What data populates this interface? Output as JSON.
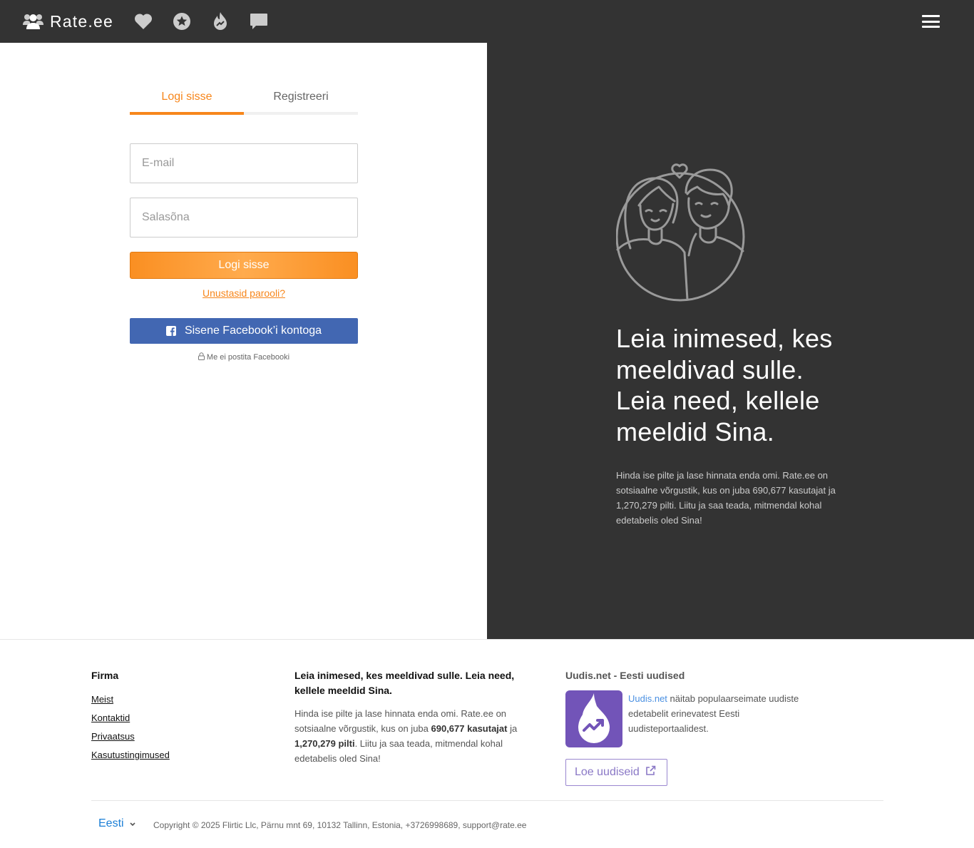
{
  "navbar": {
    "brand": "Rate.ee",
    "icons": [
      "users-icon",
      "heart-icon",
      "star-icon",
      "fire-icon",
      "chat-icon",
      "hamburger-menu-icon"
    ]
  },
  "auth": {
    "tabs": {
      "login": "Logi sisse",
      "register": "Registreeri"
    },
    "email_placeholder": "E-mail",
    "password_placeholder": "Salasõna",
    "login_button": "Logi sisse",
    "forgot_password": "Unustasid parooli?",
    "facebook_button": "Sisene Facebook’i kontoga",
    "facebook_note": "Me ei postita Facebooki"
  },
  "hero": {
    "title": "Leia inimesed, kes meeldivad sulle. Leia need, kellele meeldid Sina.",
    "description": "Hinda ise pilte ja lase hinnata enda omi. Rate.ee on sotsiaalne võrgustik, kus on juba 690,677 kasutajat ja 1,270,279 pilti. Liitu ja saa teada, mitmendal kohal edetabelis oled Sina!"
  },
  "footer": {
    "company": {
      "heading": "Firma",
      "links": [
        "Meist",
        "Kontaktid",
        "Privaatsus",
        "Kasutustingimused"
      ]
    },
    "about": {
      "title": "Leia inimesed, kes meeldivad sulle. Leia need, kellele meeldid Sina.",
      "text_1": "Hinda ise pilte ja lase hinnata enda omi. Rate.ee on sotsiaalne võrgustik, kus on juba ",
      "users_count": "690,677 kasutajat",
      "text_2": " ja ",
      "photos_count": "1,270,279 pilti",
      "text_3": ". Liitu ja saa teada, mitmendal kohal edetabelis oled Sina!"
    },
    "news": {
      "heading": "Uudis.net - Eesti uudised",
      "link_text": "Uudis.net",
      "text": " näitab populaarseimate uudiste edetabelit erinevatest Eesti uudisteportaalidest.",
      "button": "Loe uudiseid"
    },
    "language": "Eesti",
    "copyright": "Copyright © 2025 Flirtic Llc, Pärnu mnt 69, 10132 Tallinn, Estonia, +3726998689, support@rate.ee"
  },
  "colors": {
    "navbar": "#333333",
    "accent": "#f7861b",
    "facebook": "#4267b2",
    "uudis": "#7254b8",
    "link_blue": "#1a7ed6"
  }
}
